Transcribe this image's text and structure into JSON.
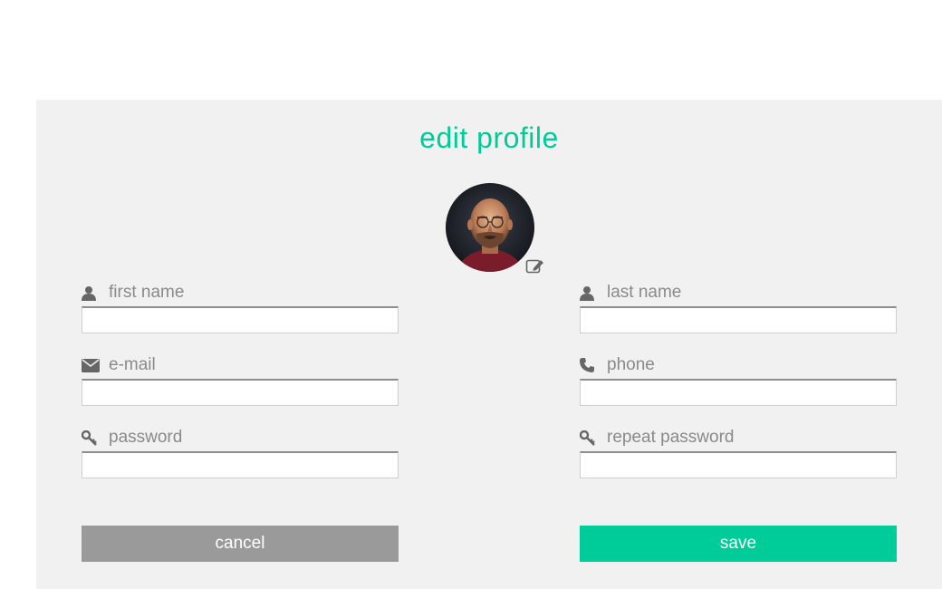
{
  "form": {
    "title": "edit profile",
    "avatar_alt": "profile photo",
    "fields": {
      "first_name": {
        "label": "first name",
        "value": ""
      },
      "last_name": {
        "label": "last name",
        "value": ""
      },
      "email": {
        "label": "e-mail",
        "value": ""
      },
      "phone": {
        "label": "phone",
        "value": ""
      },
      "password": {
        "label": "password",
        "value": ""
      },
      "repeat_password": {
        "label": "repeat password",
        "value": ""
      }
    },
    "buttons": {
      "cancel": "cancel",
      "save": "save"
    }
  },
  "colors": {
    "accent": "#00cc99",
    "cancel": "#9a9a9a",
    "panel": "#f1f1f1",
    "label": "#8a8a8a"
  },
  "icons": {
    "first_name": "user-icon",
    "last_name": "user-icon",
    "email": "envelope-icon",
    "phone": "phone-icon",
    "password": "key-icon",
    "repeat_password": "key-icon",
    "avatar_edit": "edit-icon"
  }
}
